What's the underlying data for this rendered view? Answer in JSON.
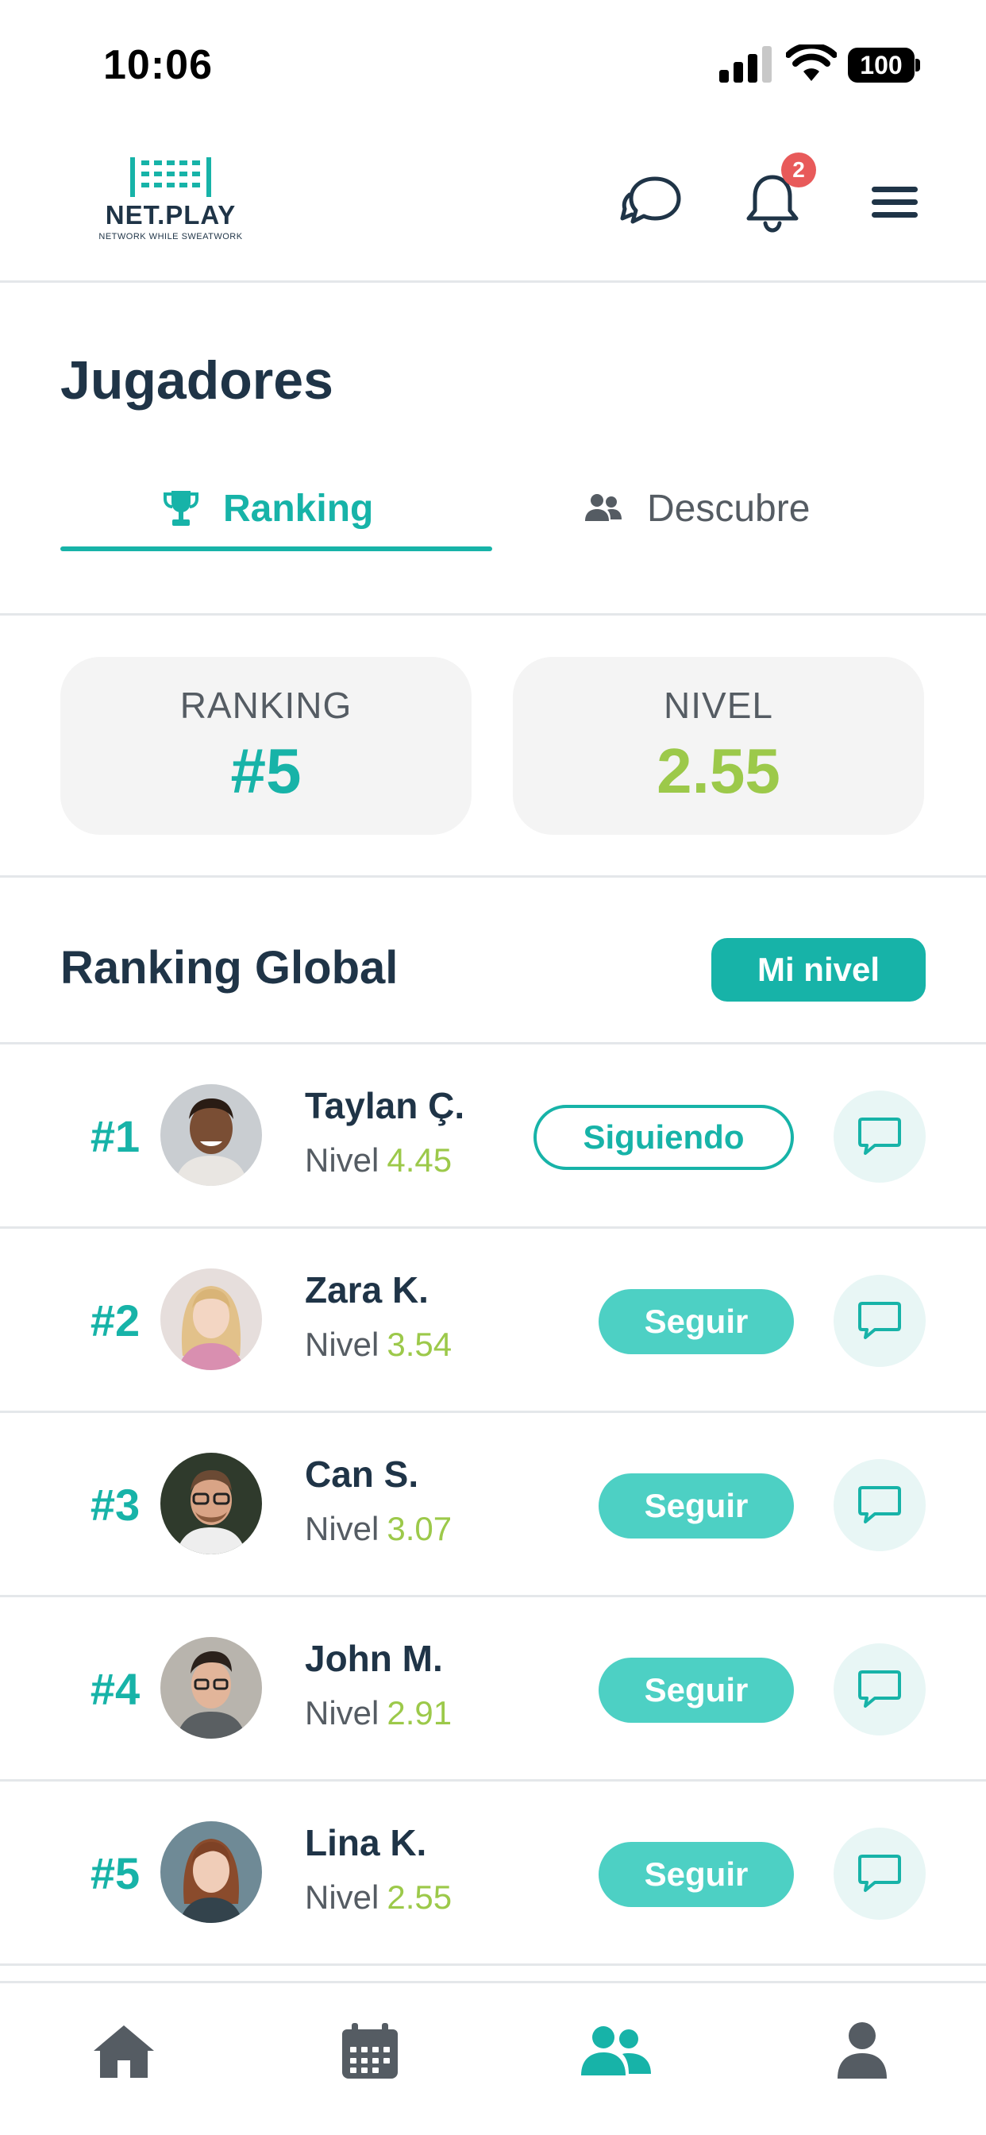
{
  "status_bar": {
    "time": "10:06",
    "battery": "100"
  },
  "header": {
    "logo_name": "NET.PLAY",
    "logo_tagline": "NETWORK WHILE SWEATWORK",
    "notification_count": "2"
  },
  "page": {
    "title": "Jugadores"
  },
  "tabs": [
    {
      "label": "Ranking",
      "icon": "trophy-icon",
      "active": true
    },
    {
      "label": "Descubre",
      "icon": "users-icon",
      "active": false
    }
  ],
  "stats": {
    "ranking_label": "RANKING",
    "ranking_value": "#5",
    "level_label": "NIVEL",
    "level_value": "2.55"
  },
  "section": {
    "title": "Ranking Global",
    "mi_nivel_label": "Mi nivel"
  },
  "level_prefix": "Nivel",
  "players": [
    {
      "rank": "#1",
      "name": "Taylan Ç.",
      "level": "4.45",
      "follow_label": "Siguiendo"
    },
    {
      "rank": "#2",
      "name": "Zara K.",
      "level": "3.54",
      "follow_label": "Seguir"
    },
    {
      "rank": "#3",
      "name": "Can S.",
      "level": "3.07",
      "follow_label": "Seguir"
    },
    {
      "rank": "#4",
      "name": "John M.",
      "level": "2.91",
      "follow_label": "Seguir"
    },
    {
      "rank": "#5",
      "name": "Lina K.",
      "level": "2.55",
      "follow_label": "Seguir"
    }
  ],
  "bottom_nav": [
    {
      "icon": "home-icon",
      "active": false
    },
    {
      "icon": "calendar-icon",
      "active": false
    },
    {
      "icon": "users-icon",
      "active": true
    },
    {
      "icon": "profile-icon",
      "active": false
    }
  ],
  "colors": {
    "accent": "#17b3a8",
    "accent_light": "#4dd0c4",
    "level_green": "#9cc94a",
    "text_dark": "#1f3447",
    "badge_red": "#e85a5a"
  }
}
